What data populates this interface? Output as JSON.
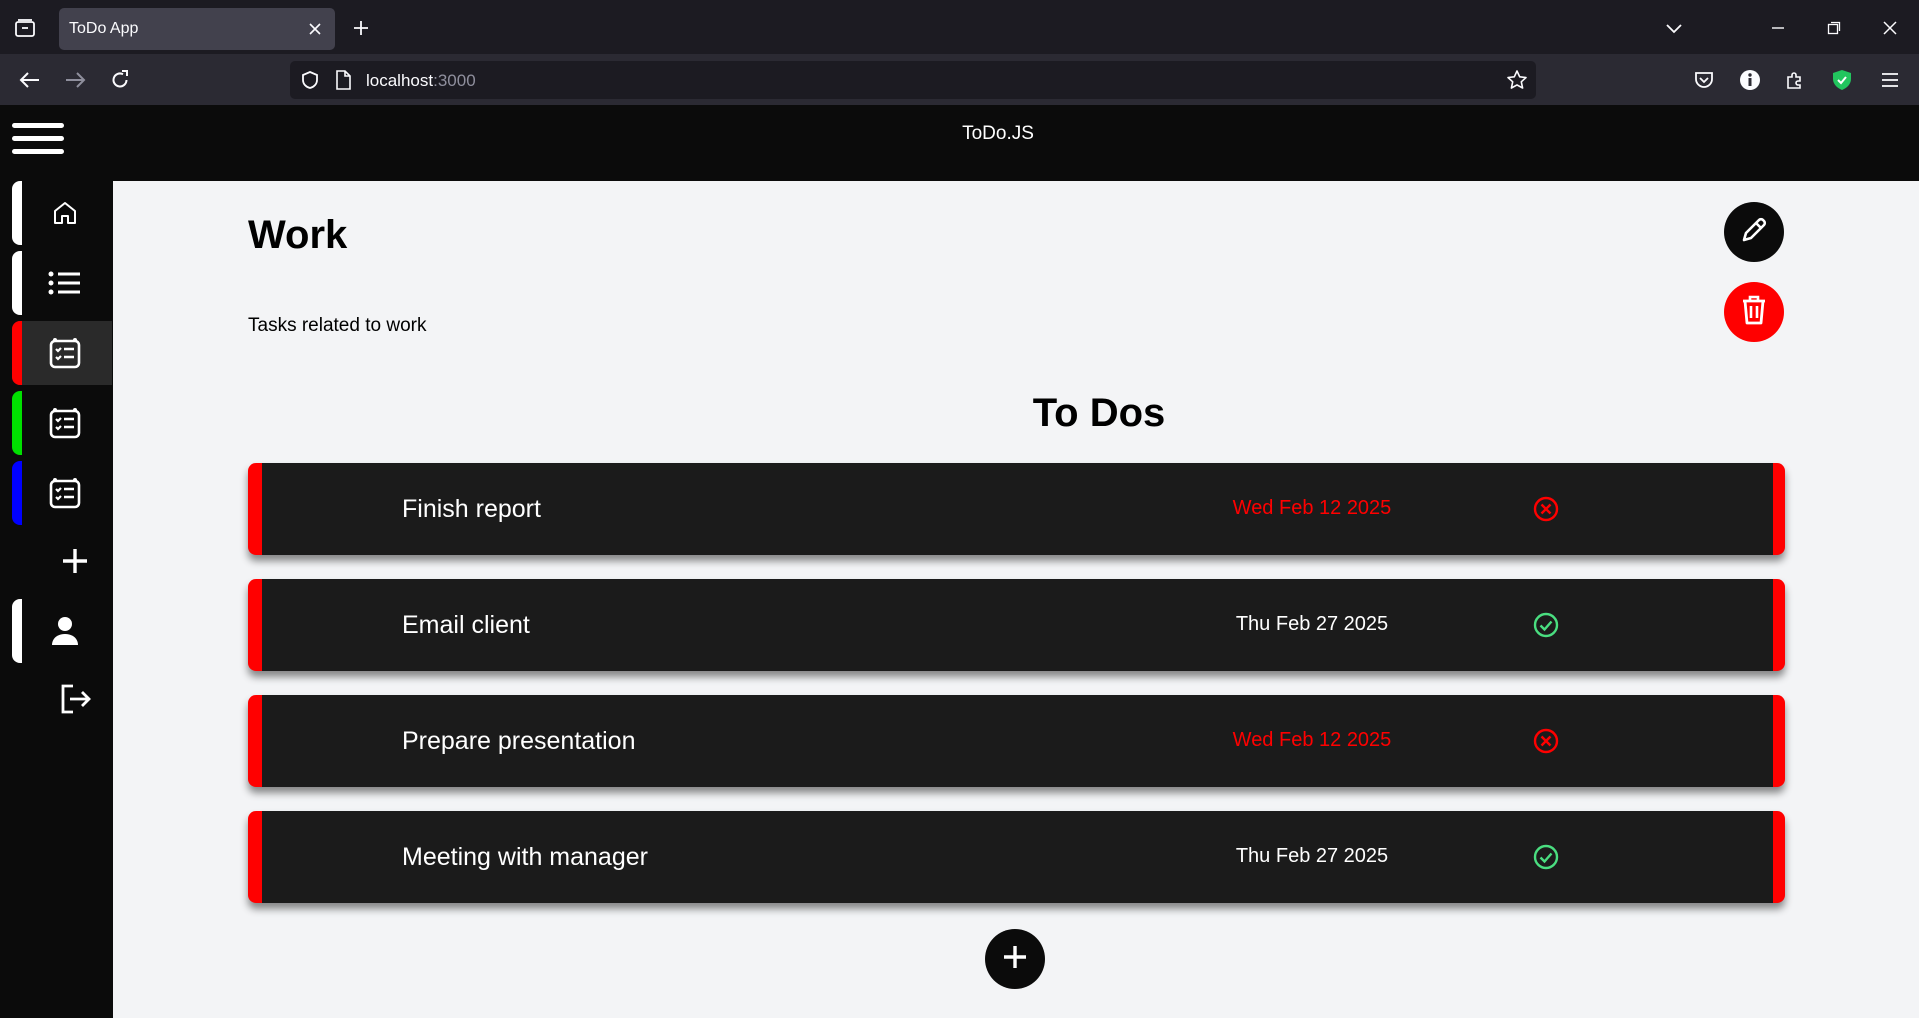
{
  "browser": {
    "tab_title": "ToDo App",
    "url_host": "localhost",
    "url_port": ":3000"
  },
  "app": {
    "title": "ToDo.JS"
  },
  "sidebar": {
    "items": [
      {
        "name": "home",
        "icon": "home-icon",
        "stripe": "#ffffff"
      },
      {
        "name": "lists",
        "icon": "list-icon",
        "stripe": "#ffffff"
      },
      {
        "name": "list-red",
        "icon": "checklist-icon",
        "stripe": "#ff0000",
        "active": true
      },
      {
        "name": "list-green",
        "icon": "checklist-icon",
        "stripe": "#00e000"
      },
      {
        "name": "list-blue",
        "icon": "checklist-icon",
        "stripe": "#0000ff"
      },
      {
        "name": "add-list",
        "icon": "plus-icon"
      },
      {
        "name": "profile",
        "icon": "user-icon",
        "stripe": "#ffffff"
      },
      {
        "name": "logout",
        "icon": "logout-icon"
      }
    ]
  },
  "list": {
    "title": "Work",
    "description": "Tasks related to work",
    "section_title": "To Dos",
    "accent": "#ff0000"
  },
  "todos": [
    {
      "title": "Finish report",
      "date": "Wed Feb 12 2025",
      "overdue": true,
      "status": "x-circle-icon"
    },
    {
      "title": "Email client",
      "date": "Thu Feb 27 2025",
      "overdue": false,
      "status": "check-circle-icon"
    },
    {
      "title": "Prepare presentation",
      "date": "Wed Feb 12 2025",
      "overdue": true,
      "status": "x-circle-icon"
    },
    {
      "title": "Meeting with manager",
      "date": "Thu Feb 27 2025",
      "overdue": false,
      "status": "check-circle-icon"
    }
  ],
  "colors": {
    "overdue": "#ff0000",
    "done": "#4ade80",
    "header": "#0b0b0b"
  }
}
